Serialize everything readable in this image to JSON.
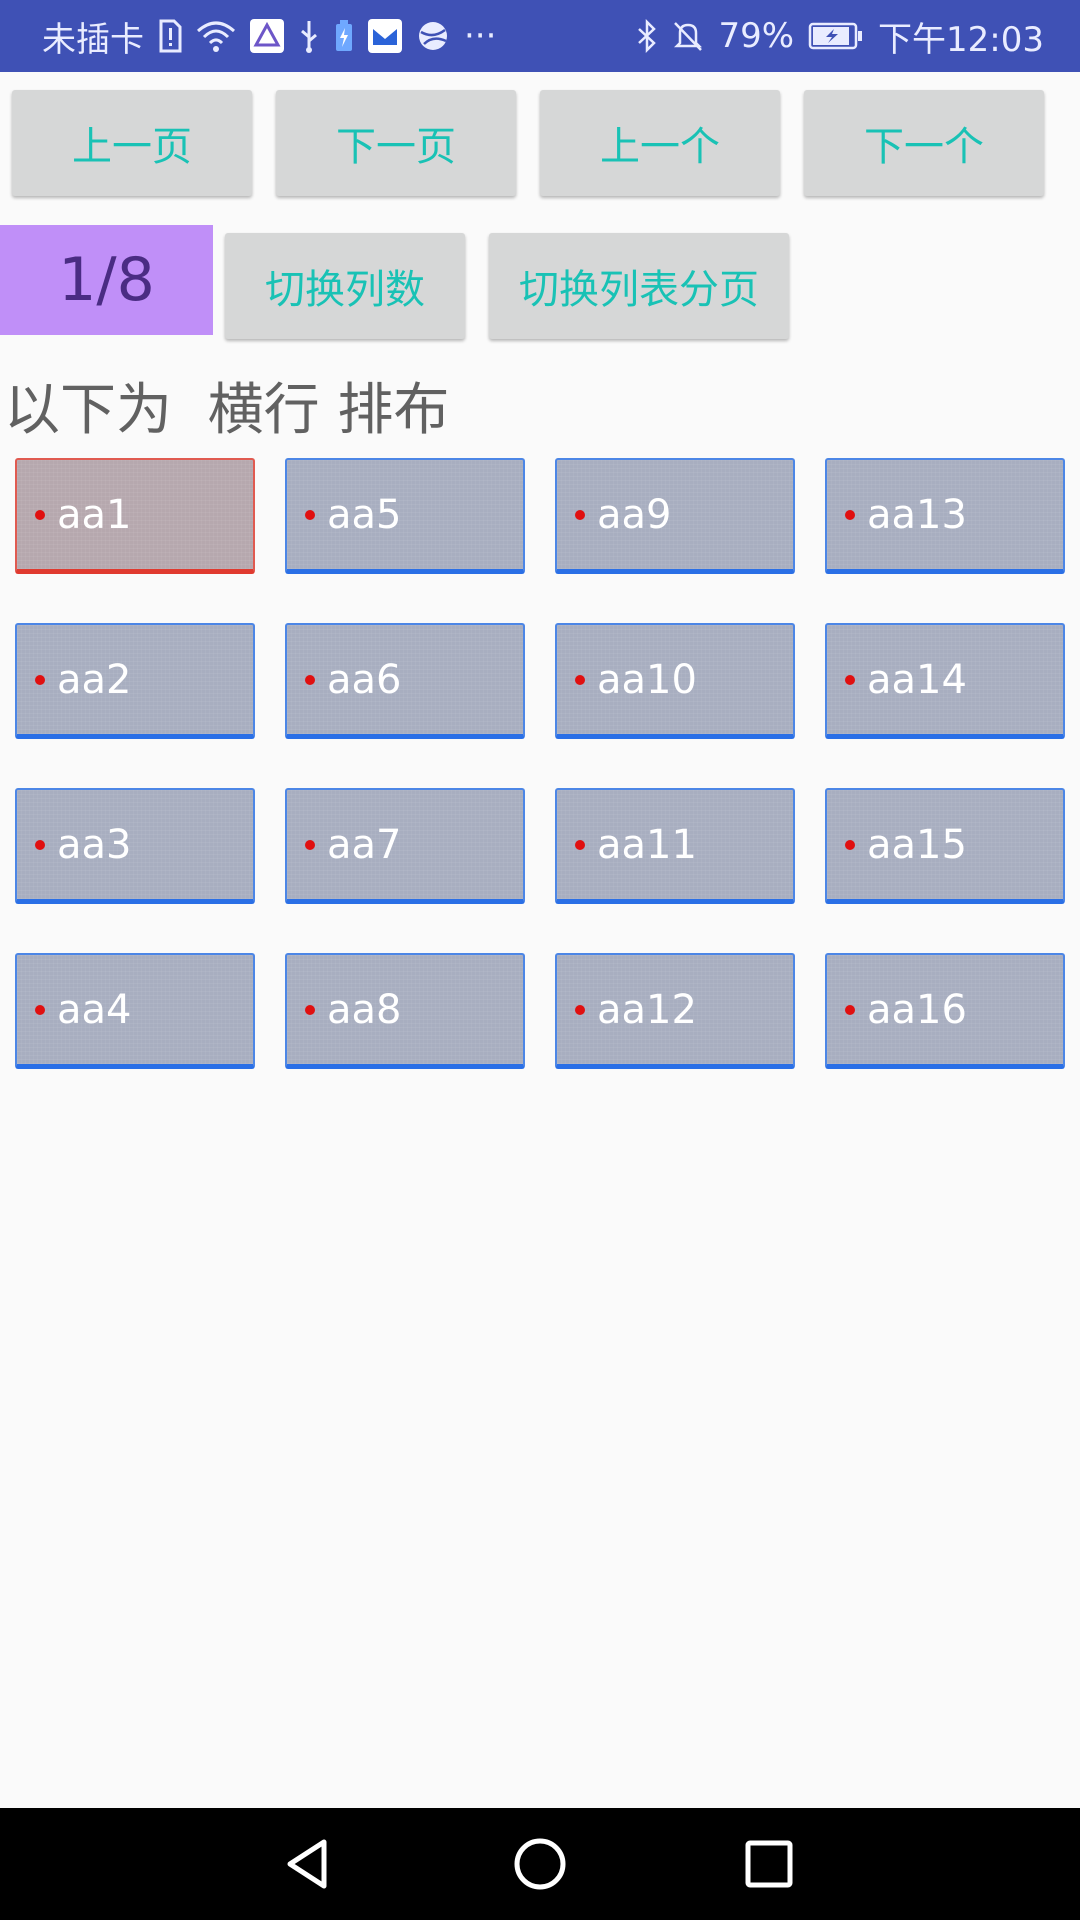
{
  "status_bar": {
    "carrier": "未插卡",
    "overflow": "···",
    "battery": "79%",
    "time": "下午12:03"
  },
  "toolbar": {
    "prev_page": "上一页",
    "next_page": "下一页",
    "prev_item": "上一个",
    "next_item": "下一个",
    "toggle_columns": "切换列数",
    "toggle_list_paging": "切换列表分页"
  },
  "page_indicator": "1/8",
  "section_title": "以下为  横行 排布",
  "grid": {
    "selected": "aa1",
    "items": [
      "aa1",
      "aa2",
      "aa3",
      "aa4",
      "aa5",
      "aa6",
      "aa7",
      "aa8",
      "aa9",
      "aa10",
      "aa11",
      "aa12",
      "aa13",
      "aa14",
      "aa15",
      "aa16"
    ]
  },
  "colors": {
    "status_bar": "#3f51b5",
    "button_text": "#19c2b5",
    "indicator_bg": "#c08ff8",
    "item_border": "#2a6fe6",
    "selected_border": "#e03a2f"
  }
}
